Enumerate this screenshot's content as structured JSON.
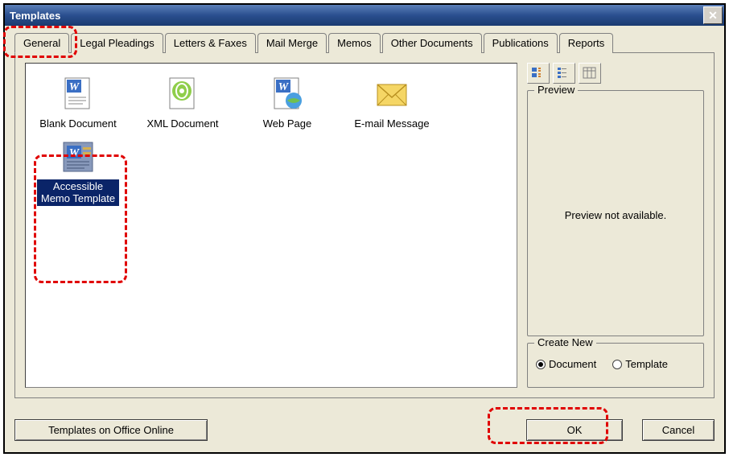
{
  "window": {
    "title": "Templates",
    "close_symbol": "✕"
  },
  "tabs": [
    {
      "label": "General",
      "active": true
    },
    {
      "label": "Legal Pleadings"
    },
    {
      "label": "Letters & Faxes"
    },
    {
      "label": "Mail Merge"
    },
    {
      "label": "Memos"
    },
    {
      "label": "Other Documents"
    },
    {
      "label": "Publications"
    },
    {
      "label": "Reports"
    }
  ],
  "templates": [
    {
      "label": "Blank Document",
      "icon": "word-doc"
    },
    {
      "label": "XML Document",
      "icon": "xml-doc"
    },
    {
      "label": "Web Page",
      "icon": "web-doc"
    },
    {
      "label": "E-mail Message",
      "icon": "email"
    },
    {
      "label": "Accessible Memo Template",
      "icon": "word-template",
      "selected": true
    }
  ],
  "preview": {
    "group_label": "Preview",
    "text": "Preview not available."
  },
  "create_new": {
    "group_label": "Create New",
    "options": [
      {
        "label": "Document",
        "checked": true
      },
      {
        "label": "Template",
        "checked": false
      }
    ]
  },
  "buttons": {
    "templates_online": "Templates on Office Online",
    "ok": "OK",
    "cancel": "Cancel"
  }
}
